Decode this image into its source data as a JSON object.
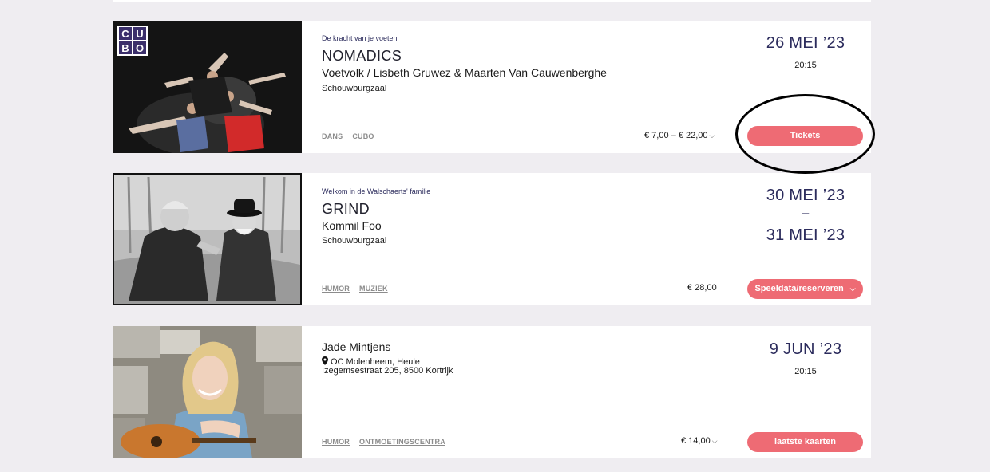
{
  "events": [
    {
      "subtitle": "De kracht van je voeten",
      "title": "NOMADICS",
      "artist": "Voetvolk / Lisbeth Gruwez & Maarten Van Cauwenberghe",
      "venue": "Schouwburgzaal",
      "tags": [
        "DANS",
        "CUBO"
      ],
      "price": "€ 7,00 – € 22,00",
      "date": "26 MEI ’23",
      "time": "20:15",
      "button": "Tickets",
      "logo": "CUBO"
    },
    {
      "subtitle": "Welkom in de Walschaerts' familie",
      "title": "GRIND",
      "artist": "Kommil Foo",
      "venue": "Schouwburgzaal",
      "tags": [
        "HUMOR",
        "MUZIEK"
      ],
      "price": "€ 28,00",
      "date_start": "30 MEI ’23",
      "date_sep": "–",
      "date_end": "31 MEI ’23",
      "button": "Speeldata/reserveren"
    },
    {
      "title": "Jade Mintjens",
      "location_name": "OC Molenheem, Heule",
      "address": "Izegemsestraat 205, 8500 Kortrijk",
      "tags": [
        "HUMOR",
        "ONTMOETINGSCENTRA"
      ],
      "price": "€ 14,00",
      "date": "9 JUN ’23",
      "time": "20:15",
      "button": "laatste kaarten"
    }
  ],
  "colors": {
    "background": "#efedf1",
    "card": "#ffffff",
    "accent_button": "#ee6b74",
    "date_text": "#2b2b5c",
    "tag_text": "#8c8c8c"
  },
  "icons": {
    "chevron": "chevron-down-icon",
    "location": "map-pin-icon"
  }
}
